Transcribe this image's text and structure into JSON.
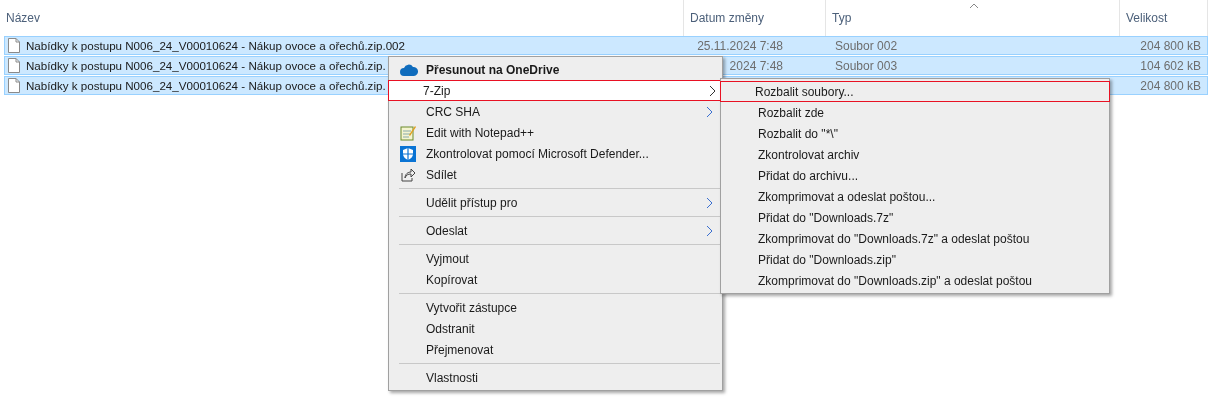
{
  "columns": [
    {
      "label": "Název"
    },
    {
      "label": "Datum změny"
    },
    {
      "label": "Typ"
    },
    {
      "label": "Velikost"
    }
  ],
  "files": [
    {
      "name": "Nabídky k postupu N006_24_V00010624 - Nákup ovoce a ořechů.zip.002",
      "date": "25.11.2024 7:48",
      "type": "Soubor 002",
      "size": "204 800 kB",
      "selected": true
    },
    {
      "name": "Nabídky k postupu N006_24_V00010624 - Nákup ovoce a ořechů.zip.",
      "date": "2024 7:48",
      "type": "Soubor 003",
      "size": "104 602 kB",
      "selected": true
    },
    {
      "name": "Nabídky k postupu N006_24_V00010624 - Nákup ovoce a ořechů.zip.",
      "size": "204 800 kB",
      "selected": true
    }
  ],
  "context_menu": [
    {
      "kind": "onedrive",
      "label": "Přesunout na OneDrive",
      "selected": false,
      "highlighted": false
    },
    {
      "kind": "submenu",
      "label": "7-Zip",
      "selected": true,
      "highlighted": true
    },
    {
      "kind": "submenu",
      "label": "CRC SHA",
      "selected": false,
      "highlighted": false
    },
    {
      "kind": "notepad",
      "label": "Edit with Notepad++",
      "selected": false,
      "highlighted": false
    },
    {
      "kind": "defender",
      "label": "Zkontrolovat pomocí Microsoft Defender...",
      "selected": false,
      "highlighted": false
    },
    {
      "kind": "share",
      "label": "Sdílet",
      "selected": false,
      "highlighted": false
    },
    {
      "kind": "separator"
    },
    {
      "kind": "submenu",
      "label": "Udělit přístup pro",
      "selected": false,
      "highlighted": false
    },
    {
      "kind": "separator"
    },
    {
      "kind": "submenu",
      "label": "Odeslat",
      "selected": false,
      "highlighted": false
    },
    {
      "kind": "separator"
    },
    {
      "kind": "item",
      "label": "Vyjmout",
      "selected": false,
      "highlighted": false
    },
    {
      "kind": "item",
      "label": "Kopírovat",
      "selected": false,
      "highlighted": false
    },
    {
      "kind": "separator"
    },
    {
      "kind": "item",
      "label": "Vytvořit zástupce",
      "selected": false,
      "highlighted": false
    },
    {
      "kind": "item",
      "label": "Odstranit",
      "selected": false,
      "highlighted": false
    },
    {
      "kind": "item",
      "label": "Přejmenovat",
      "selected": false,
      "highlighted": false
    },
    {
      "kind": "separator"
    },
    {
      "kind": "item",
      "label": "Vlastnosti",
      "selected": false,
      "highlighted": false
    }
  ],
  "submenu": [
    {
      "label": "Rozbalit soubory...",
      "highlighted": true
    },
    {
      "label": "Rozbalit zde",
      "highlighted": false
    },
    {
      "label": "Rozbalit do \"*\\\"",
      "highlighted": false
    },
    {
      "label": "Zkontrolovat archiv",
      "highlighted": false
    },
    {
      "label": "Přidat do archivu...",
      "highlighted": false
    },
    {
      "label": "Zkomprimovat a odeslat poštou...",
      "highlighted": false
    },
    {
      "label": "Přidat do \"Downloads.7z\"",
      "highlighted": false
    },
    {
      "label": "Zkomprimovat do \"Downloads.7z\" a odeslat poštou",
      "highlighted": false
    },
    {
      "label": "Přidat do \"Downloads.zip\"",
      "highlighted": false
    },
    {
      "label": "Zkomprimovat do \"Downloads.zip\" a odeslat poštou",
      "highlighted": false
    }
  ]
}
